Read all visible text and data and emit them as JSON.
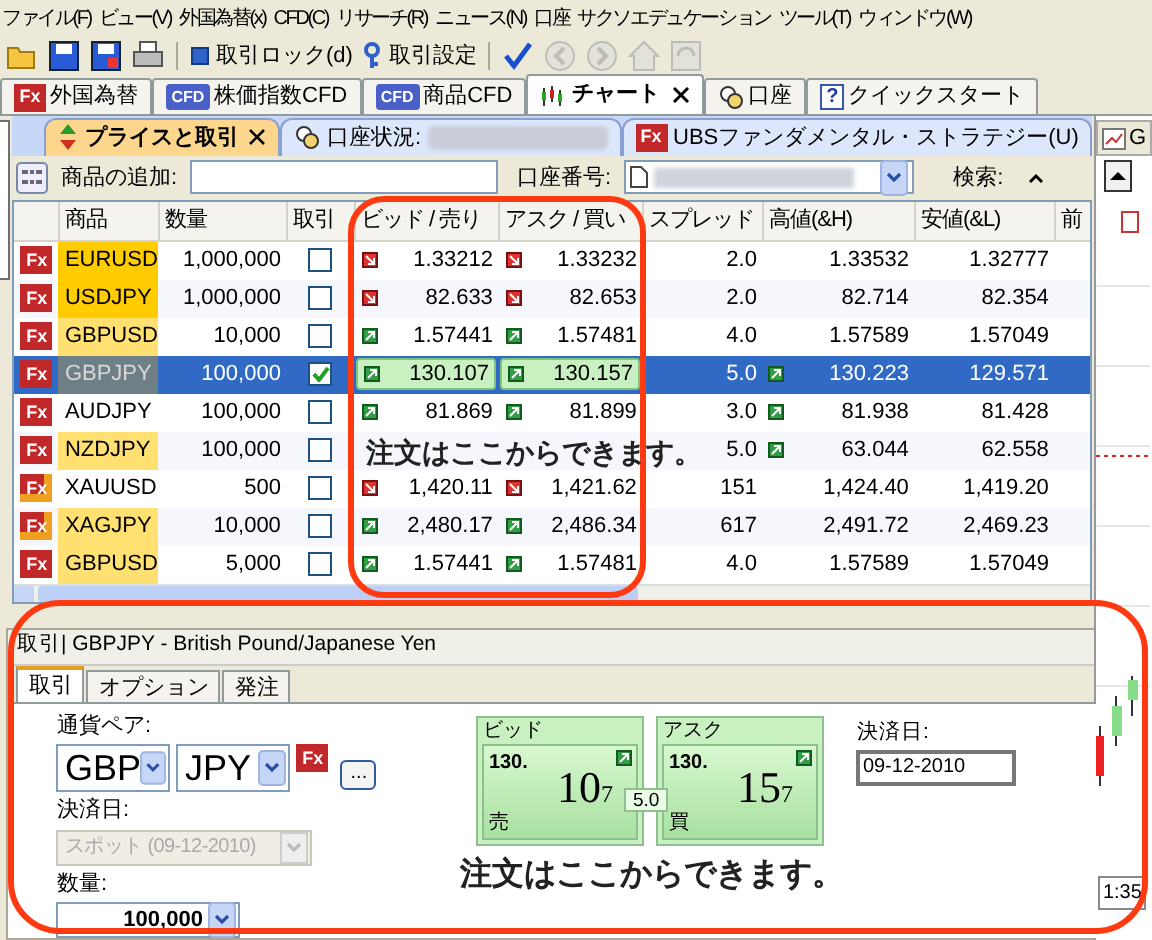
{
  "menu": [
    "ファイル(F)",
    "ビュー(V)",
    "外国為替(x)",
    "CFD(C)",
    "リサーチ(R)",
    "ニュース(N)",
    "口座",
    "サクソエデュケーション",
    "ツール(T)",
    "ウィンドウ(W)"
  ],
  "toolbar": [
    {
      "kind": "open",
      "disabled": false
    },
    {
      "kind": "save",
      "disabled": false
    },
    {
      "kind": "save-all",
      "disabled": false
    },
    {
      "kind": "print",
      "disabled": false
    },
    {
      "kind": "lock",
      "label": "取引ロック(d)",
      "disabled": false
    },
    {
      "kind": "settings",
      "label": "取引設定",
      "disabled": false
    },
    {
      "kind": "check",
      "disabled": false
    },
    {
      "kind": "back",
      "disabled": true
    },
    {
      "kind": "forward",
      "disabled": true
    },
    {
      "kind": "home",
      "disabled": true
    },
    {
      "kind": "refresh",
      "disabled": true
    }
  ],
  "main_tabs": [
    {
      "badge": "Fx",
      "kind": "fx",
      "label": "外国為替",
      "selected": false,
      "closable": false
    },
    {
      "badge": "CFD",
      "kind": "cfd",
      "label": "株価指数CFD",
      "selected": false,
      "closable": false
    },
    {
      "badge": "CFD",
      "kind": "cfd",
      "label": "商品CFD",
      "selected": false,
      "closable": false
    },
    {
      "kind": "chart",
      "label": "チャート",
      "selected": true,
      "closable": true
    },
    {
      "kind": "account",
      "label": "口座",
      "selected": false,
      "closable": false
    },
    {
      "badge": "?",
      "kind": "help",
      "label": "クイックスタート",
      "selected": false,
      "closable": false
    }
  ],
  "inner_tabs": [
    {
      "kind": "updown",
      "label": "プライスと取引",
      "selected": true,
      "closable": true
    },
    {
      "kind": "account",
      "label": "口座状況:",
      "selected": false,
      "closable": false
    },
    {
      "badge": "Fx",
      "kind": "fx",
      "label": "UBSファンダメンタル・ストラテジー(U)",
      "selected": false,
      "closable": false
    }
  ],
  "filter": {
    "add_label": "商品の追加:",
    "account_label": "口座番号:",
    "search_label": "検索:"
  },
  "table": {
    "columns": [
      "商品",
      "数量",
      "取引",
      "ビッド / 売り",
      "アスク / 買い",
      "スプレッド",
      "高値(&H)",
      "安値(&L)",
      "前"
    ],
    "rows": [
      {
        "badge": "Fx",
        "metal": false,
        "symbol": "EURUSD",
        "color": "#ffcc00",
        "quantity": "1,000,000",
        "checked": false,
        "selected": false,
        "bid": {
          "value": "1.33212",
          "rising": false
        },
        "ask": {
          "value": "1.33232",
          "rising": false
        },
        "spread": "2.0",
        "high": {
          "value": "1.33532",
          "arrow": false
        },
        "low": "1.32777"
      },
      {
        "badge": "Fx",
        "metal": false,
        "symbol": "USDJPY",
        "color": "#ffcc00",
        "quantity": "1,000,000",
        "checked": false,
        "selected": false,
        "bid": {
          "value": "82.633",
          "rising": false
        },
        "ask": {
          "value": "82.653",
          "rising": false
        },
        "spread": "2.0",
        "high": {
          "value": "82.714",
          "arrow": false
        },
        "low": "82.354"
      },
      {
        "badge": "Fx",
        "metal": false,
        "symbol": "GBPUSD",
        "color": "#ffe070",
        "quantity": "10,000",
        "checked": false,
        "selected": false,
        "bid": {
          "value": "1.57441",
          "rising": true
        },
        "ask": {
          "value": "1.57481",
          "rising": true
        },
        "spread": "4.0",
        "high": {
          "value": "1.57589",
          "arrow": false
        },
        "low": "1.57049"
      },
      {
        "badge": "Fx",
        "metal": false,
        "symbol": "GBPJPY",
        "quantity": "100,000",
        "checked": true,
        "selected": true,
        "bid": {
          "value": "130.107",
          "rising": true
        },
        "ask": {
          "value": "130.157",
          "rising": true
        },
        "spread": "5.0",
        "high": {
          "value": "130.223",
          "arrow": true
        },
        "low": "129.571"
      },
      {
        "badge": "Fx",
        "metal": false,
        "symbol": "AUDJPY",
        "quantity": "100,000",
        "checked": false,
        "selected": false,
        "bid": {
          "value": "81.869",
          "rising": true
        },
        "ask": {
          "value": "81.899",
          "rising": true
        },
        "spread": "3.0",
        "high": {
          "value": "81.938",
          "arrow": true
        },
        "low": "81.428"
      },
      {
        "badge": "Fx",
        "metal": false,
        "symbol": "NZDJPY",
        "color": "#ffe070",
        "quantity": "100,000",
        "checked": false,
        "selected": false,
        "spread": "5.0",
        "high": {
          "value": "63.044",
          "arrow": true
        },
        "low": "62.558"
      },
      {
        "badge": "Fx",
        "metal": true,
        "symbol": "XAUUSD",
        "quantity": "500",
        "checked": false,
        "selected": false,
        "bid": {
          "value": "1,420.11",
          "rising": false
        },
        "ask": {
          "value": "1,421.62",
          "rising": false
        },
        "spread": "151",
        "high": {
          "value": "1,424.40",
          "arrow": false
        },
        "low": "1,419.20"
      },
      {
        "badge": "Fx",
        "metal": true,
        "symbol": "XAGJPY",
        "color": "#ffe070",
        "quantity": "10,000",
        "checked": false,
        "selected": false,
        "bid": {
          "value": "2,480.17",
          "rising": true
        },
        "ask": {
          "value": "2,486.34",
          "rising": true
        },
        "spread": "617",
        "high": {
          "value": "2,491.72",
          "arrow": false
        },
        "low": "2,469.23"
      },
      {
        "badge": "Fx",
        "metal": false,
        "symbol": "GBPUSD",
        "color": "#ffe070",
        "quantity": "5,000",
        "checked": false,
        "selected": false,
        "bid": {
          "value": "1.57441",
          "rising": true
        },
        "ask": {
          "value": "1.57481",
          "rising": true
        },
        "spread": "4.0",
        "high": {
          "value": "1.57589",
          "arrow": false
        },
        "low": "1.57049"
      }
    ]
  },
  "order_panel": {
    "title": "取引| GBPJPY - British Pound/Japanese Yen",
    "tabs": [
      {
        "label": "取引",
        "selected": true
      },
      {
        "label": "オプション",
        "selected": false
      },
      {
        "label": "発注",
        "selected": false
      }
    ],
    "pair_label": "通貨ペア:",
    "base": "GBP",
    "quote": "JPY",
    "badge": "Fx",
    "more": "...",
    "settlement_label": "決済日:",
    "settlement": "スポット (09-12-2010)",
    "settlement_disabled": true,
    "quantity_label": "数量:",
    "quantity": "100,000",
    "quotes": [
      {
        "label": "ビッド",
        "big": "130.",
        "pips": "10",
        "fraction": "7",
        "side": "売",
        "rising": true
      },
      {
        "label": "アスク",
        "big": "130.",
        "pips": "15",
        "fraction": "7",
        "side": "買",
        "rising": true
      }
    ],
    "spread": "5.0",
    "value_date_label": "決済日:",
    "value_date": "09-12-2010"
  },
  "chart_strip": {
    "tab": "G",
    "time": "1:35"
  },
  "annotations": [
    {
      "text": "注文はここからできます。"
    },
    {
      "text": "注文はここからできます。"
    }
  ]
}
